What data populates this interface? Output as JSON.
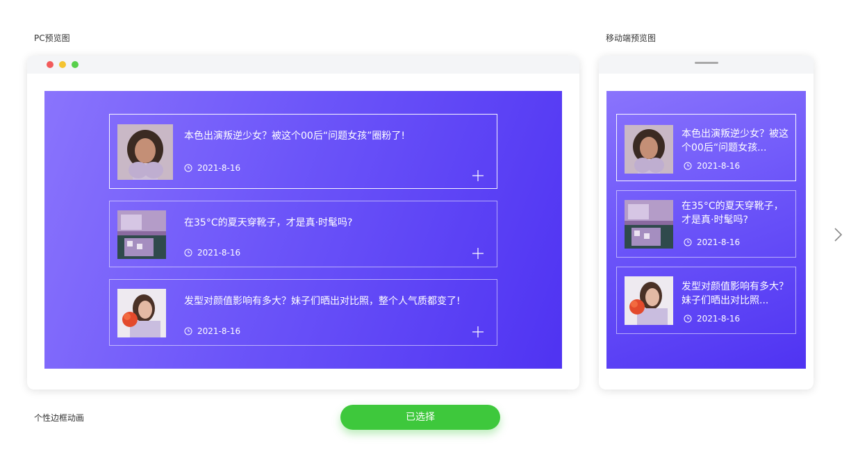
{
  "labels": {
    "pc_preview": "PC预览图",
    "mobile_preview": "移动端预览图",
    "style_name": "个性边框动画"
  },
  "articles": [
    {
      "title": "本色出演叛逆少女？被这个00后“问题女孩”圈粉了!",
      "mobile_title": "本色出演叛逆少女？被这个00后“问题女孩...",
      "date": "2021-8-16",
      "thumb_icon": "woman-covering-face-photo"
    },
    {
      "title": "在35°C的夏天穿靴子，才是真·时髦吗?",
      "mobile_title": "在35°C的夏天穿靴子，才是真·时髦吗?",
      "date": "2021-8-16",
      "thumb_icon": "purple-fashion-photo"
    },
    {
      "title": "发型对颜值影响有多大？妹子们晒出对比照，整个人气质都变了!",
      "mobile_title": "发型对颜值影响有多大？妹子们晒出对比照...",
      "date": "2021-8-16",
      "thumb_icon": "girl-with-flower-photo"
    }
  ],
  "button": {
    "label": "已选择"
  },
  "colors": {
    "gradient_start": "#8a74fc",
    "gradient_end": "#4f33f2",
    "button": "#3ec83c"
  },
  "icons": {
    "clock": "clock-icon",
    "plus": "plus-icon",
    "next": "chevron-right-icon"
  }
}
